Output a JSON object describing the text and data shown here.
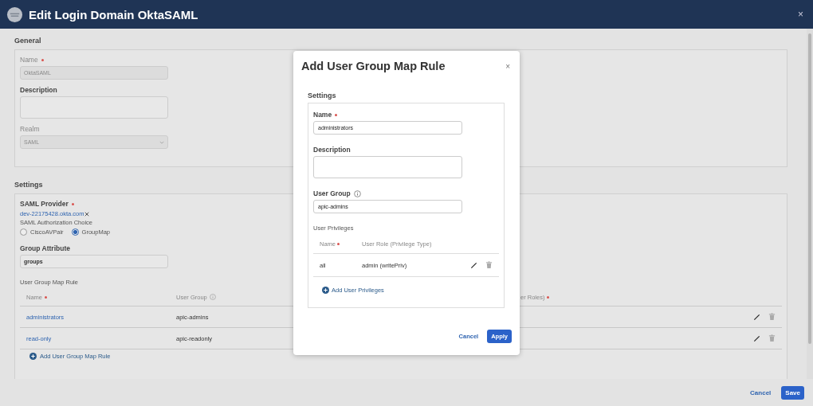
{
  "window": {
    "title": "Edit Login Domain OktaSAML",
    "close": "×"
  },
  "general": {
    "title": "General",
    "fields": [
      {
        "kind": "text",
        "label": "Name",
        "required": true,
        "disabled": true,
        "value": "OktaSAML"
      },
      {
        "kind": "textarea",
        "label": "Description",
        "disabled": false
      },
      {
        "kind": "select",
        "label": "Realm",
        "disabled": true,
        "value": "SAML"
      }
    ]
  },
  "settings": {
    "title": "Settings",
    "saml_provider": {
      "label": "SAML Provider",
      "required": true,
      "value": "dev-22175428.okta.com"
    },
    "authorization": {
      "label": "SAML Authorization Choice",
      "options": [
        {
          "label": "CiscoAVPair",
          "selected": false
        },
        {
          "label": "GroupMap",
          "selected": true
        }
      ]
    },
    "group_attribute": {
      "label": "Group Attribute",
      "value": "groups"
    },
    "rule_table": {
      "title": "User Group Map Rule",
      "columns": [
        {
          "label": "Name",
          "required": true
        },
        {
          "label": "User Group",
          "info": true
        },
        {
          "label": "er Roles)",
          "required": true
        }
      ],
      "rows": [
        {
          "name": "administrators",
          "user_group": "apic-admins"
        },
        {
          "name": "read-only",
          "user_group": "apic-readonly"
        }
      ],
      "add_label": "Add User Group Map Rule"
    }
  },
  "dialog": {
    "title": "Add User Group Map Rule",
    "close": "×",
    "section": "Settings",
    "fields": [
      {
        "kind": "text",
        "label": "Name",
        "required": true,
        "value": "administrators"
      },
      {
        "kind": "textarea",
        "label": "Description"
      },
      {
        "kind": "text",
        "label": "User Group",
        "info": true,
        "value": "apic-admins"
      }
    ],
    "privileges": {
      "title": "User Privileges",
      "columns": [
        {
          "label": "Name",
          "required": true
        },
        {
          "label": "User Role (Privilege Type)"
        }
      ],
      "rows": [
        {
          "name": "all",
          "role": "admin (writePriv)"
        }
      ],
      "add_label": "Add User Privileges"
    },
    "buttons": [
      {
        "label": "Cancel",
        "kind": "link"
      },
      {
        "label": "Apply",
        "kind": "primary"
      }
    ]
  },
  "footer": {
    "buttons": [
      {
        "label": "Cancel",
        "kind": "link"
      },
      {
        "label": "Save",
        "kind": "primary"
      }
    ]
  }
}
